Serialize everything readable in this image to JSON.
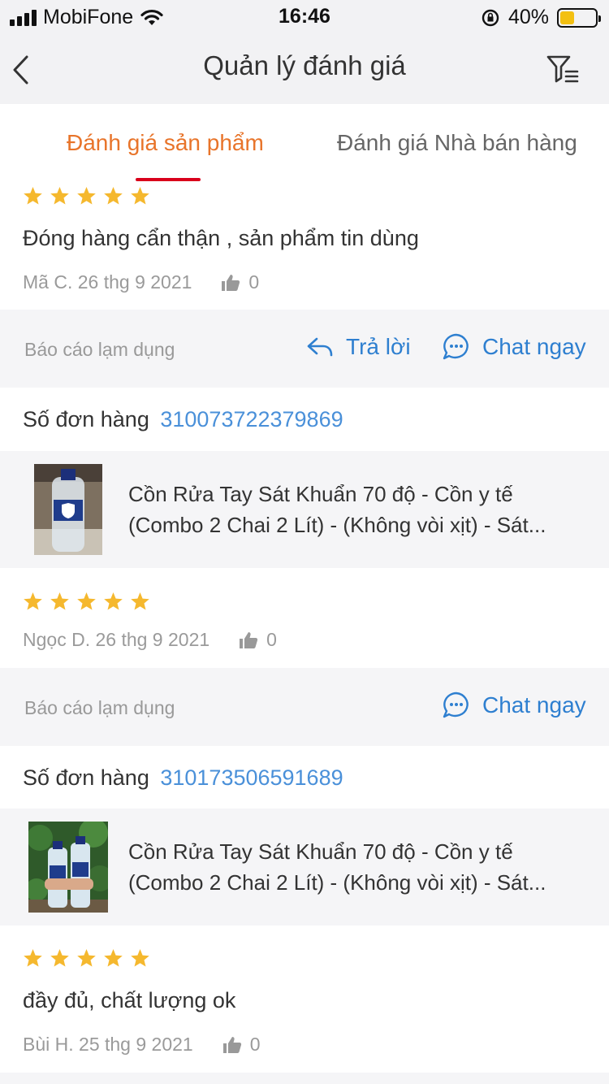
{
  "status_bar": {
    "carrier": "MobiFone",
    "time": "16:46",
    "battery_percent": "40%",
    "battery_level": 0.4,
    "battery_color": "#f3c012"
  },
  "nav": {
    "title": "Quản lý đánh giá",
    "back_icon": "chevron-left-icon",
    "filter_icon": "filter-list-icon"
  },
  "tabs": [
    {
      "label": "Đánh giá sản phẩm",
      "active": true
    },
    {
      "label": "Đánh giá Nhà bán hàng",
      "active": false
    }
  ],
  "colors": {
    "accent_tab": "#e8742a",
    "tab_underline": "#d9001b",
    "star": "#f5b82e",
    "link": "#2e7fd0",
    "order_number": "#4a90d9"
  },
  "reviews": [
    {
      "rating": 5,
      "text": "Đóng hàng cẩn thận , sản phẩm tin dùng",
      "author_date": "Mã C. 26 thg 9 2021",
      "likes": "0",
      "report_label": "Báo cáo lạm dụng",
      "reply_label": "Trả lời",
      "chat_label": "Chat ngay",
      "order_label": "Số đơn hàng",
      "order_number": "310073722379869",
      "product_line1": "Cồn Rửa Tay Sát Khuẩn 70 độ - Cồn y tế",
      "product_line2": "(Combo 2 Chai 2 Lít) - (Không vòi xịt) - Sát..."
    },
    {
      "rating": 5,
      "text": "",
      "author_date": "Ngọc D. 26 thg 9 2021",
      "likes": "0",
      "report_label": "Báo cáo lạm dụng",
      "chat_label": "Chat ngay",
      "order_label": "Số đơn hàng",
      "order_number": "310173506591689",
      "product_line1": "Cồn Rửa Tay Sát Khuẩn 70 độ - Cồn y tế",
      "product_line2": "(Combo 2 Chai 2 Lít) - (Không vòi xịt) - Sát..."
    },
    {
      "rating": 5,
      "text": "đầy đủ, chất lượng ok",
      "author_date": "Bùi H. 25 thg 9 2021",
      "likes": "0"
    }
  ]
}
